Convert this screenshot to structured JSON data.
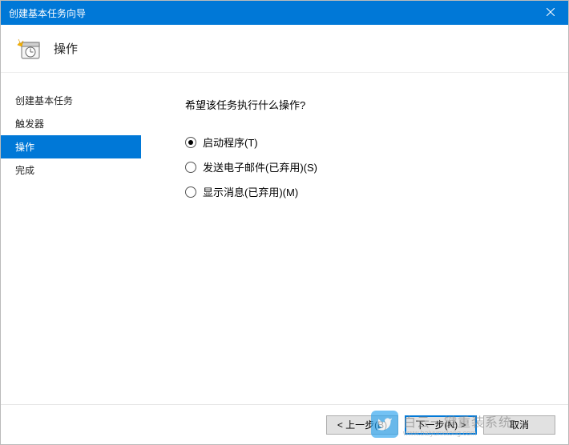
{
  "titlebar": {
    "title": "创建基本任务向导"
  },
  "header": {
    "title": "操作"
  },
  "sidebar": {
    "items": [
      {
        "label": "创建基本任务"
      },
      {
        "label": "触发器"
      },
      {
        "label": "操作"
      },
      {
        "label": "完成"
      }
    ]
  },
  "content": {
    "prompt": "希望该任务执行什么操作?",
    "options": [
      {
        "label": "启动程序(T)",
        "checked": true
      },
      {
        "label": "发送电子邮件(已弃用)(S)",
        "checked": false
      },
      {
        "label": "显示消息(已弃用)(M)",
        "checked": false
      }
    ]
  },
  "footer": {
    "back": "< 上一步(B)",
    "next": "下一步(N) >",
    "cancel": "取消"
  },
  "watermark": {
    "brand": "白云一键重装系统",
    "url": "www.baiyunxitong.com"
  }
}
